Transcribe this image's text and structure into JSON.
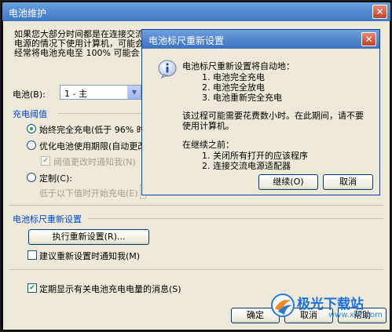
{
  "window": {
    "title": "电池维护",
    "close": "✕",
    "intro": "如果您大部分时间都是在连接交流电源的情况下使用计算机，可能会经常将电池充电至 100% 可能会加快电池老化的速度并缩短其使用期限。",
    "battery_label": "电池(B):",
    "battery_value": "1 - 主",
    "charge_section": "充电阈值",
    "opt_full": "始终完全充电(低于 96% 时开始充电)",
    "opt_optimize": "优化电池使用期限(自动更改)",
    "opt_optimize_notify": "阈值更改时通知我(N)",
    "opt_custom": "定制(C):",
    "opt_custom_below": "低于以下值时开始充电(E)",
    "recal_section": "电池标尺重新设置",
    "recal_button": "执行重新设置(R)...",
    "recal_notify": "建议重新设置时通知我(M)",
    "periodic_msg": "定期显示有关电池充电电量的消息(S)",
    "ok": "确定",
    "cancel": "取消",
    "help": "帮助"
  },
  "dialog": {
    "title": "电池标尺重新设置",
    "close": "✕",
    "line1": "电池标尺重新设置将自动地：",
    "step1": "1.  电池完全充电",
    "step2": "2.  电池完全放电",
    "step3": "3.  电池重新完全充电",
    "note1": "该过程可能需要花费数小时。在此期间，请不要",
    "note2": "使用计算机。",
    "before": "在继续之前：",
    "pre1": "1.  关闭所有打开的应该程序",
    "pre2": "2.  连接交流电源适配器",
    "continue": "继续(O)",
    "cancel": "取消"
  },
  "watermark": {
    "brand": "极光下载站",
    "url": "www.xz7.com"
  },
  "colors": {
    "titlebar": "#3d77c4",
    "section_text": "#0046d5",
    "dialog_bg": "#ece9d8"
  },
  "icons": [
    "close-icon",
    "info-icon",
    "dropdown-arrow-icon",
    "aurora-logo-icon"
  ]
}
